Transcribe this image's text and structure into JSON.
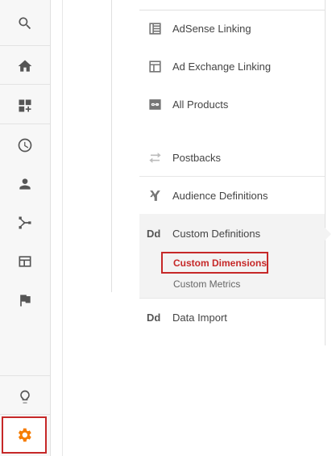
{
  "rail": {
    "items": [
      {
        "icon": "search-icon"
      },
      {
        "icon": "home-icon"
      },
      {
        "icon": "customization-icon"
      },
      {
        "icon": "realtime-clock-icon"
      },
      {
        "icon": "audience-person-icon"
      },
      {
        "icon": "acquisition-icon"
      },
      {
        "icon": "behavior-icon"
      },
      {
        "icon": "conversions-flag-icon"
      },
      {
        "icon": "discover-lightbulb-icon"
      },
      {
        "icon": "admin-gear-icon"
      }
    ],
    "admin_color": "#f57c00",
    "highlight_color": "#c62828"
  },
  "menu": {
    "adsense": "AdSense Linking",
    "adexchange": "Ad Exchange Linking",
    "all_products": "All Products",
    "postbacks": "Postbacks",
    "audience_definitions": "Audience Definitions",
    "custom_definitions": {
      "badge": "Dd",
      "label": "Custom Definitions",
      "children": {
        "custom_dimensions": "Custom Dimensions",
        "custom_metrics": "Custom Metrics"
      }
    },
    "data_import": {
      "badge": "Dd",
      "label": "Data Import"
    }
  }
}
